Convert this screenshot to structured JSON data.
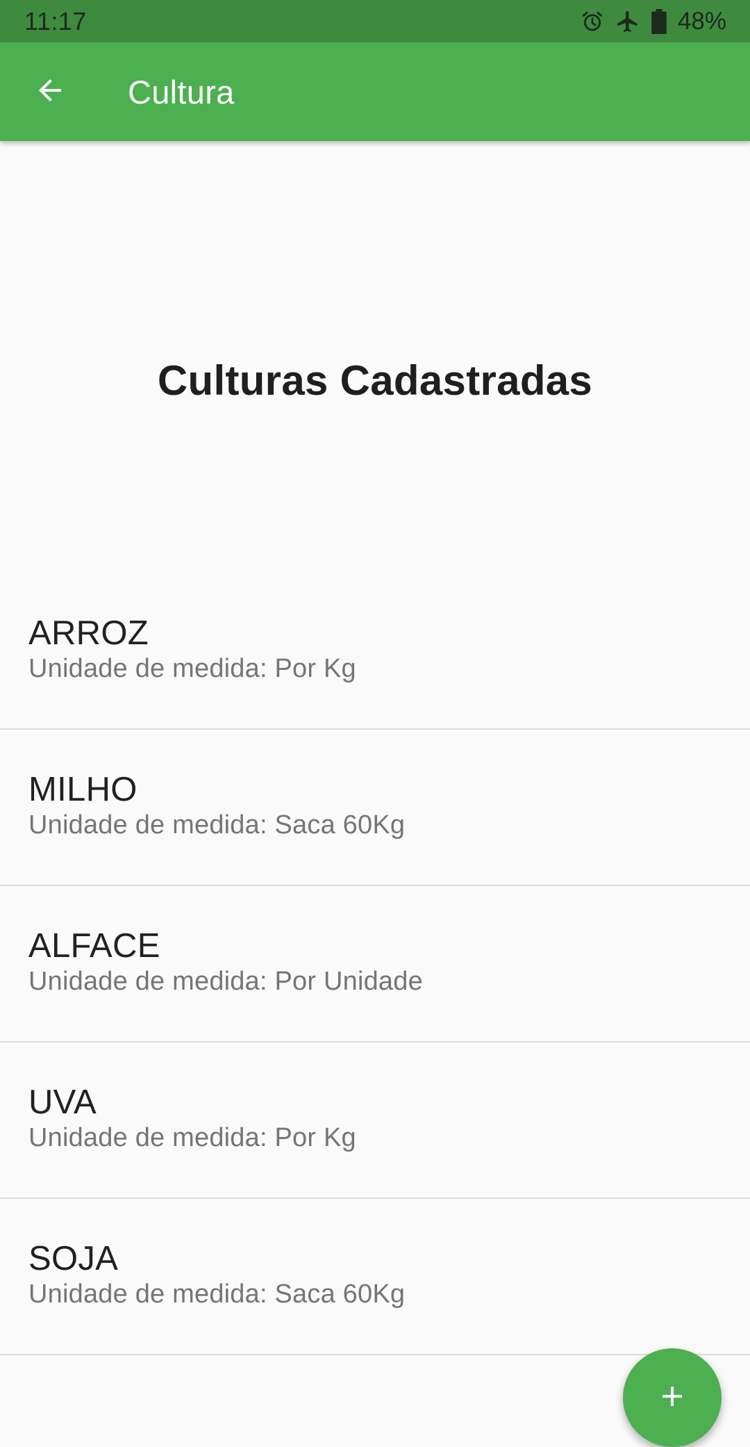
{
  "status_bar": {
    "time": "11:17",
    "battery_text": "48%",
    "icons": [
      "alarm-icon",
      "airplane-icon",
      "battery-icon"
    ]
  },
  "app_bar": {
    "title": "Cultura",
    "back_icon": "arrow-back-icon",
    "color": "#4caf50"
  },
  "main": {
    "heading": "Culturas Cadastradas",
    "items": [
      {
        "name": "ARROZ",
        "unit": "Unidade de medida: Por Kg"
      },
      {
        "name": "MILHO",
        "unit": "Unidade de medida: Saca 60Kg"
      },
      {
        "name": "ALFACE",
        "unit": "Unidade de medida: Por Unidade"
      },
      {
        "name": "UVA",
        "unit": "Unidade de medida: Por Kg"
      },
      {
        "name": "SOJA",
        "unit": "Unidade de medida: Saca 60Kg"
      }
    ]
  },
  "fab": {
    "icon": "plus-icon",
    "color": "#4caf50"
  }
}
